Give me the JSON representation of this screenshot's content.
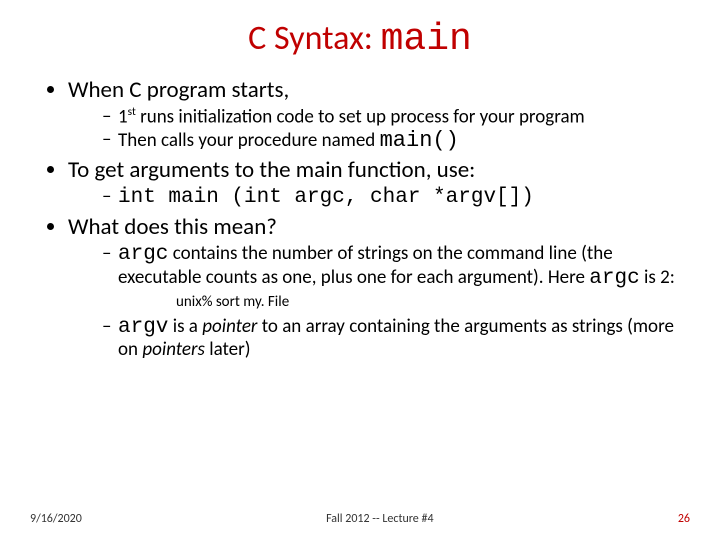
{
  "title": {
    "prefix": "C Syntax: ",
    "mono": "main"
  },
  "bullets": {
    "b1": "When C program starts,",
    "b1_1a": "1",
    "b1_1sup": "st",
    "b1_1b": " runs initialization code to set up process for your program",
    "b1_2a": "Then calls your procedure named ",
    "b1_2mono": "main()",
    "b2": "To get arguments to the main function, use:",
    "b2_1mono": "int main (int argc, char *argv[])",
    "b3": "What does this mean?",
    "b3_1a": "argc",
    "b3_1b": " contains the number of strings on the command line (the executable counts as one, plus one for each argument). Here ",
    "b3_1c": "argc",
    "b3_1d": " is 2:",
    "code": "unix% sort my. File",
    "b3_2a": "argv",
    "b3_2b": " is a ",
    "b3_2c": "pointer",
    "b3_2d": " to an array containing the arguments as strings (more on ",
    "b3_2e": "pointers",
    "b3_2f": " later)"
  },
  "footer": {
    "date": "9/16/2020",
    "center": "Fall 2012 -- Lecture #4",
    "page": "26"
  }
}
